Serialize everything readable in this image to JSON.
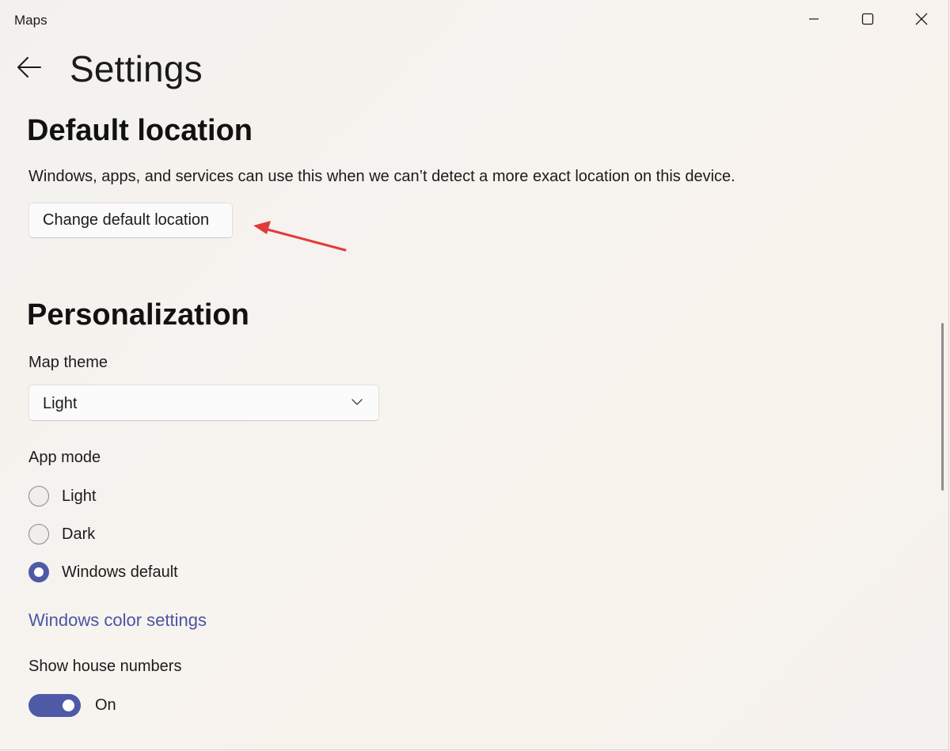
{
  "window": {
    "title": "Maps",
    "controls": {
      "minimize": "minimize-icon",
      "maximize": "maximize-icon",
      "close": "close-icon"
    }
  },
  "header": {
    "back_icon": "back-arrow-icon",
    "title": "Settings"
  },
  "default_location": {
    "heading": "Default location",
    "description": "Windows, apps, and services can use this when we can’t detect a more exact location on this device.",
    "button_label": "Change default location"
  },
  "personalization": {
    "heading": "Personalization",
    "map_theme": {
      "label": "Map theme",
      "selected": "Light"
    },
    "app_mode": {
      "label": "App mode",
      "options": [
        {
          "label": "Light",
          "checked": false
        },
        {
          "label": "Dark",
          "checked": false
        },
        {
          "label": "Windows default",
          "checked": true
        }
      ]
    },
    "color_link": "Windows color settings",
    "house_numbers": {
      "label": "Show house numbers",
      "state_text": "On",
      "on": true
    }
  },
  "colors": {
    "accent": "#4f5aa6",
    "link": "#4a55a2",
    "annotation_arrow": "#e03b3b"
  }
}
